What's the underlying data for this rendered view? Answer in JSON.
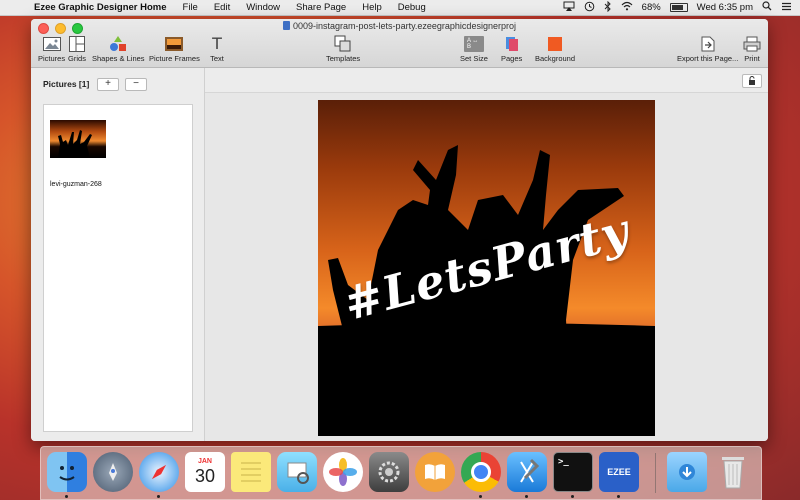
{
  "menubar": {
    "app_name": "Ezee Graphic Designer Home",
    "items": [
      "File",
      "Edit",
      "Window",
      "Share Page",
      "Help",
      "Debug"
    ],
    "battery": "68%",
    "battery_level": 0.68,
    "clock": "Wed 6:35 pm"
  },
  "window": {
    "title": "0009-instagram-post-lets-party.ezeegraphicdesignerproj"
  },
  "toolbar": {
    "pictures": "Pictures",
    "grids": "Grids",
    "shapes_lines": "Shapes & Lines",
    "picture_frames": "Picture Frames",
    "text": "Text",
    "templates": "Templates",
    "set_size": "Set Size",
    "set_size_icon_text": "A ↔ B",
    "pages": "Pages",
    "background": "Background",
    "background_color": "#f05a22",
    "export": "Export this Page...",
    "print": "Print"
  },
  "left_panel": {
    "header": "Pictures [1]",
    "add_label": "+",
    "remove_label": "−",
    "items": [
      {
        "label": "levi-guzman-268"
      }
    ]
  },
  "canvas": {
    "artwork_text": "#LetsParty"
  },
  "dock": {
    "calendar_month": "JAN",
    "calendar_day": "30",
    "ezee_label": "EZEE",
    "terminal_prompt": ">_"
  }
}
